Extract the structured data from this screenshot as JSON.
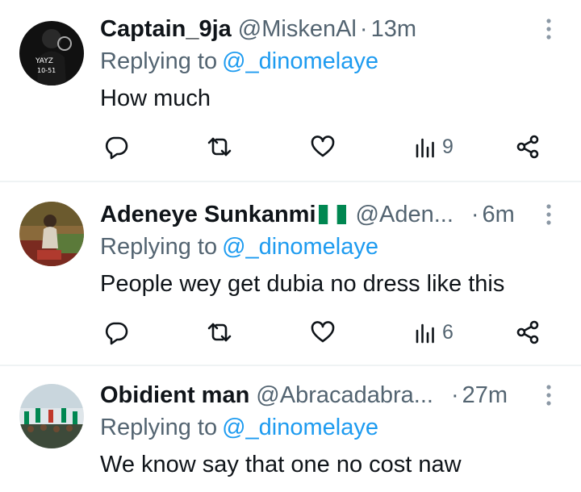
{
  "colors": {
    "text": "#0f1419",
    "secondary": "#536471",
    "link": "#1d9bf0",
    "divider": "#eff3f4"
  },
  "replies": [
    {
      "display_name": "Captain_9ja",
      "has_flag": false,
      "handle": "@MiskenAl",
      "separator": "·",
      "time": "13m",
      "replying_prefix": "Replying to",
      "replying_to": "@_dinomelaye",
      "text": "How much",
      "views": "9",
      "avatar_text_1": "YAYZ",
      "avatar_text_2": "10-51"
    },
    {
      "display_name": "Adeneye Sunkanmi",
      "has_flag": true,
      "handle": "@Aden...",
      "separator": "·",
      "time": "6m",
      "replying_prefix": "Replying to",
      "replying_to": "@_dinomelaye",
      "text": "People wey get dubia no dress like this",
      "views": "6"
    },
    {
      "display_name": "Obidient man",
      "has_flag": false,
      "handle": "@Abracadabra...",
      "separator": "·",
      "time": "27m",
      "replying_prefix": "Replying to",
      "replying_to": "@_dinomelaye",
      "text": "We know say that one no cost naw"
    }
  ],
  "icons": {
    "reply": "speech-bubble-icon",
    "retweet": "retweet-icon",
    "like": "heart-icon",
    "views": "bar-chart-icon",
    "share": "share-icon",
    "more": "more-vertical-icon"
  }
}
